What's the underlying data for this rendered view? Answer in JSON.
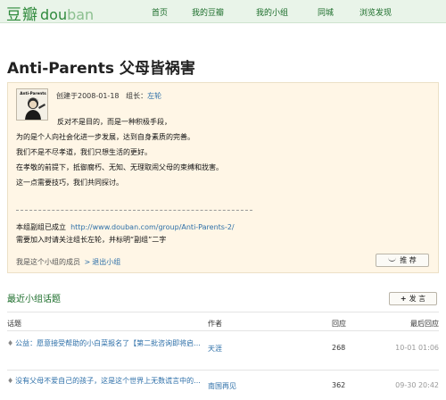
{
  "site": {
    "logo_cn": "豆瓣",
    "logo_en_a": "dou",
    "logo_en_b": "ban"
  },
  "nav": {
    "items": [
      "首页",
      "我的豆瓣",
      "我的小组",
      "同城",
      "浏览发现"
    ]
  },
  "group": {
    "title": "Anti-Parents 父母皆祸害",
    "avatar_caption": "Anti-Parents",
    "created_label": "创建于",
    "created_date": "2008-01-18",
    "leader_label": "组长：",
    "leader_name": "左轮",
    "description": [
      "反对不是目的，而是一种积极手段，",
      "为的是个人向社会化进一步发展，达到自身素质的完善。",
      "我们不是不尽孝道，我们只想生活的更好。",
      "在孝敬的前提下，抵御腐朽、无知、无理取闹父母的束缚和戕害。",
      "这一点需要技巧，我们共同探讨。"
    ],
    "subgroup_text": "本组副组已成立",
    "subgroup_url": "http://www.douban.com/group/Anti-Parents-2/",
    "subgroup_note": "需要加入时请关注组长左轮，并标明“副组”二字",
    "member_status": "我是这个小组的成员",
    "exit_link": "退出小组",
    "recommend_label": "推 荐"
  },
  "recent": {
    "title": "最近小组话题",
    "post_label": "发 言",
    "headers": {
      "topic": "话题",
      "author": "作者",
      "replies": "回应",
      "last": "最后回应"
    },
    "rows": [
      {
        "topic": "公益：愿意接受帮助的小白菜报名了【第二批咨询即将启...",
        "author": "天涯",
        "replies": "268",
        "last": "10-01 01:06"
      },
      {
        "topic": "没有父母不爱自己的孩子，这是这个世界上无数谎言中的...",
        "author": "南国再见",
        "replies": "362",
        "last": "09-30 20:42"
      }
    ]
  },
  "colors": {
    "brand_green": "#2f8a3c",
    "link_blue": "#2d6fa8",
    "infobox_bg": "#fff6e6"
  }
}
